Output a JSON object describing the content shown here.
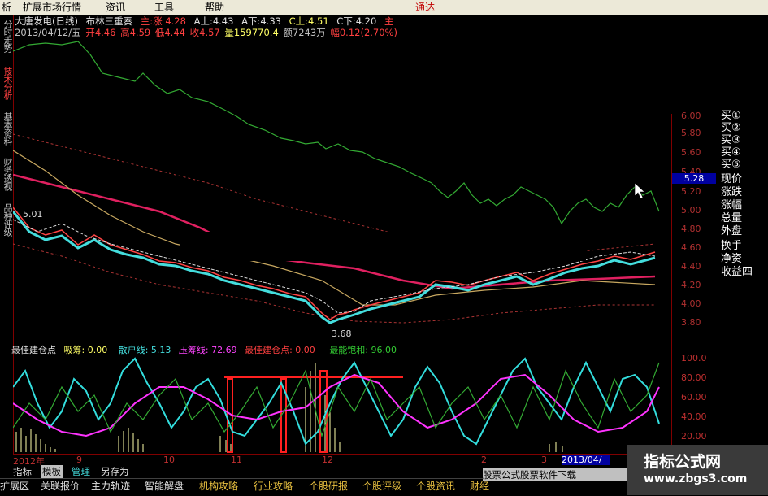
{
  "menu": {
    "items": [
      "析",
      "扩展市场行情",
      "资讯",
      "工具",
      "帮助"
    ],
    "trade": "通达"
  },
  "header": {
    "title": "大唐发电(日线)",
    "indicator": "布林三重奏",
    "zhuliang": "主:涨",
    "zhuliang_val": "4.28",
    "a_up": "A上:4.43",
    "a_down": "A下:4.33",
    "c_up": "C上:4.51",
    "c_down": "C下:4.20",
    "tail": "主",
    "date": "2013/04/12/五",
    "open": "开4.46",
    "high": "高4.59",
    "low": "低4.44",
    "close": "收4.57",
    "volume": "量159770.4",
    "amount": "额7243万",
    "change": "幅0.12(2.70%)"
  },
  "left_tabs": [
    "分时走势",
    "技术分析",
    "基本资料",
    "财务透视",
    "品种评级"
  ],
  "price_labels": {
    "high_mark": "5.01",
    "low_mark": "3.68",
    "current": "5.28"
  },
  "price_axis": [
    "6.00",
    "5.80",
    "5.60",
    "5.40",
    "5.20",
    "5.00",
    "4.80",
    "4.60",
    "4.40",
    "4.20",
    "4.00",
    "3.80"
  ],
  "right_panel": [
    "买①",
    "买②",
    "买③",
    "买④",
    "买⑤",
    "现价",
    "涨跌",
    "涨幅",
    "总量",
    "外盘",
    "换手",
    "净资",
    "收益四"
  ],
  "indicator": {
    "name": "最佳建仓点",
    "xichou": "吸筹: 0.00",
    "sanhu": "散户线: 5.13",
    "yachou": "压筹线: 72.69",
    "jiancang": "最佳建仓点: 0.00",
    "baohe": "最能饱和: 96.00",
    "axis": [
      "100.0",
      "80.00",
      "60.00",
      "40.00",
      "20.00"
    ]
  },
  "time_axis": [
    "2012年",
    "9",
    "10",
    "11",
    "12",
    "2",
    "3",
    "2013/04/"
  ],
  "tab_bar": [
    "指标",
    "模板",
    "管理",
    "另存为"
  ],
  "status_bar": [
    "扩展区",
    "关联报价",
    "主力轨迹",
    "智能解盘",
    "机构攻略",
    "行业攻略",
    "个股研报",
    "个股评级",
    "个股资讯",
    "财经"
  ],
  "promo": "股票公式股票软件下载",
  "watermark": {
    "title": "指标公式网",
    "url": "www.zbgs3.com"
  },
  "colors": {
    "up": "#ff4444",
    "down": "#44dddd",
    "green_line": "#33aa33",
    "magenta": "#ff00ff",
    "cyan": "#33dddd",
    "yellow": "#ffffaa",
    "maroon_grid": "#800000"
  }
}
